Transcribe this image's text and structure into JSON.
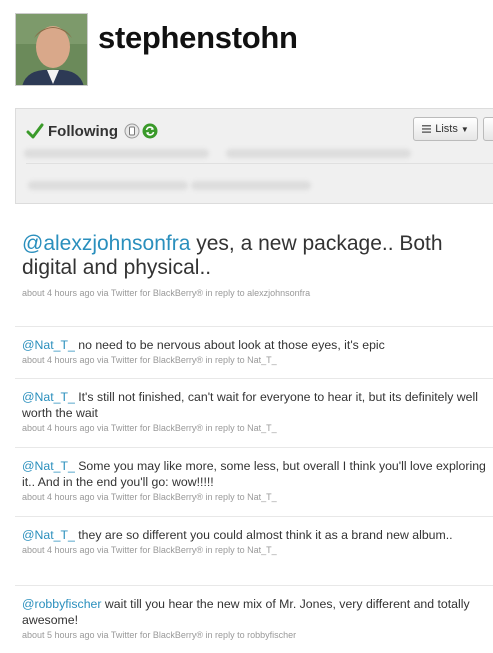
{
  "profile": {
    "username": "stephenstohn"
  },
  "follow_bar": {
    "status_label": "Following",
    "lists_label": "Lists",
    "check_color": "#3a9a2a"
  },
  "main_tweet": {
    "mention": "@alexzjohnsonfra",
    "text": " yes, a new package.. Both digital and physical..",
    "meta": "about 4 hours ago via Twitter for BlackBerry® in reply to alexzjohnsonfra"
  },
  "tweets": [
    {
      "mention": "@Nat_T_",
      "text": " no need to be nervous about look at those eyes, it's epic",
      "meta": "about 4 hours ago via Twitter for BlackBerry® in reply to Nat_T_"
    },
    {
      "mention": "@Nat_T_",
      "text": " It's still not finished, can't wait for everyone to hear it, but its definitely well worth the wait",
      "meta": "about 4 hours ago via Twitter for BlackBerry® in reply to Nat_T_"
    },
    {
      "mention": "@Nat_T_",
      "text": " Some you may like more, some less, but overall I think you'll love exploring it.. And in the end you'll go: wow!!!!!",
      "meta": "about 4 hours ago via Twitter for BlackBerry® in reply to Nat_T_"
    },
    {
      "mention": "@Nat_T_",
      "text": " they are so different you could almost think it as a brand new album..",
      "meta": "about 4 hours ago via Twitter for BlackBerry® in reply to Nat_T_"
    },
    {
      "mention": "@robbyfischer",
      "text": " wait till you hear the new mix of Mr. Jones, very different and totally awesome!",
      "meta": "about 5 hours ago via Twitter for BlackBerry® in reply to robbyfischer"
    }
  ]
}
